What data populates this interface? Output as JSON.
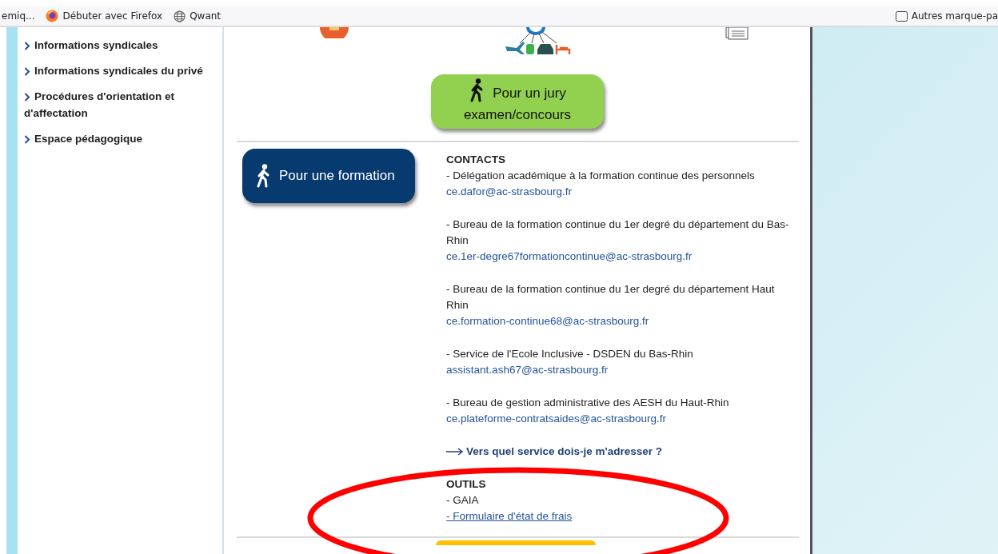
{
  "bookmarks_bar": {
    "items": [
      {
        "label": "emiq...",
        "kind": "none"
      },
      {
        "label": "Débuter avec Firefox",
        "kind": "firefox"
      },
      {
        "label": "Qwant",
        "kind": "globe"
      }
    ],
    "other": {
      "label": "Autres marque-pa"
    }
  },
  "sidebar": {
    "items": [
      {
        "label": "Informations syndicales"
      },
      {
        "label": "Informations syndicales du privé"
      },
      {
        "label": "Procédures d'orientation et d'affectation"
      },
      {
        "label": "Espace pédagogique"
      }
    ]
  },
  "jury_button": {
    "label": "Pour un jury examen/concours"
  },
  "formation_button": {
    "label": "Pour une formation"
  },
  "contacts": {
    "heading": "CONTACTS",
    "items": [
      {
        "description": "- Délégation académique à la formation continue des personnels",
        "email": "ce.dafor@ac-strasbourg.fr"
      },
      {
        "description": "- Bureau de la formation continue du 1er degré du département du Bas-Rhin",
        "email": "ce.1er-degre67formationcontinue@ac-strasbourg.fr"
      },
      {
        "description": "- Bureau de la formation continue du 1er degré du département Haut Rhin",
        "email": "ce.formation-continue68@ac-strasbourg.fr"
      },
      {
        "description": "- Service de l'Ecole Inclusive - DSDEN du Bas-Rhin",
        "email": "assistant.ash67@ac-strasbourg.fr"
      },
      {
        "description": "- Bureau de gestion administrative des AESH du Haut-Rhin",
        "email": "ce.plateforme-contratsaides@ac-strasbourg.fr"
      }
    ],
    "service_link": "Vers quel service dois-je m'adresser ?"
  },
  "tools": {
    "heading": "OUTILS",
    "items": [
      {
        "label": "- GAIA",
        "kind": "text"
      },
      {
        "label": "- Formulaire d'état de frais",
        "kind": "link"
      }
    ]
  },
  "annotation": {
    "kind": "ellipse",
    "color": "#ff0000"
  }
}
